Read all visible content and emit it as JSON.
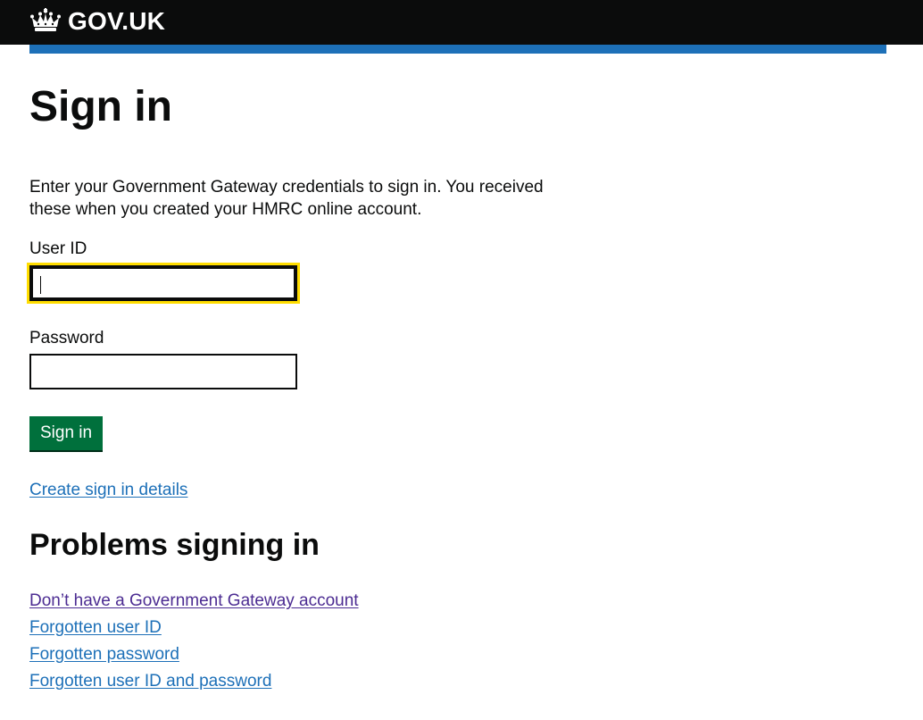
{
  "header": {
    "logo_text": "GOV.UK",
    "logo_icon": "crown-icon",
    "background": "#0b0c0c",
    "accent_bar_color": "#1d70b8"
  },
  "main": {
    "title": "Sign in",
    "intro": "Enter your Government Gateway credentials to sign in. You received these when you created your HMRC online account.",
    "user_id": {
      "label": "User ID",
      "value": "",
      "focused": true
    },
    "password": {
      "label": "Password",
      "value": ""
    },
    "signin_button_label": "Sign in",
    "create_link": "Create sign in details",
    "problems_heading": "Problems signing in",
    "problem_links": [
      "Don’t have a Government Gateway account",
      "Forgotten user ID",
      "Forgotten password",
      "Forgotten user ID and password"
    ]
  },
  "colors": {
    "button": "#00703c",
    "link": "#1d70b8",
    "visited_link": "#4c2c92",
    "focus": "#ffdd00",
    "text": "#0b0c0c"
  }
}
